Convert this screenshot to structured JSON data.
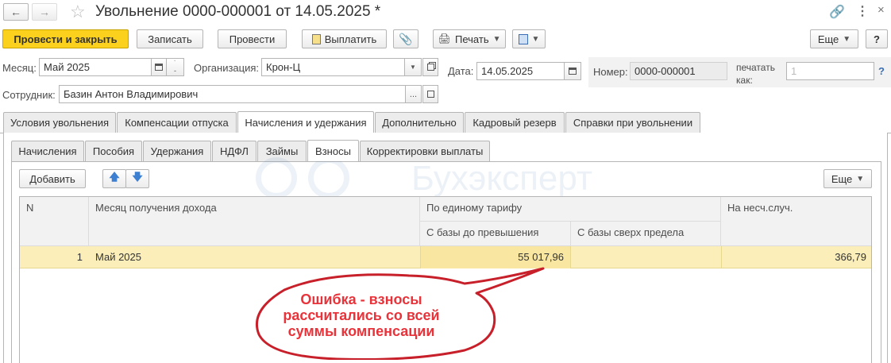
{
  "window": {
    "title": "Увольнение 0000-000001 от 14.05.2025 *"
  },
  "toolbar": {
    "post_close": "Провести и закрыть",
    "save": "Записать",
    "post": "Провести",
    "pay": "Выплатить",
    "print": "Печать",
    "more": "Еще",
    "help": "?"
  },
  "form": {
    "month_label": "Месяц:",
    "month_value": "Май 2025",
    "org_label": "Организация:",
    "org_value": "Крон-Ц",
    "date_label": "Дата:",
    "date_value": "14.05.2025",
    "number_label": "Номер:",
    "number_value": "0000-000001",
    "print_as_label_1": "печатать",
    "print_as_label_2": "как:",
    "print_as_value": "1",
    "print_as_help": "?",
    "employee_label": "Сотрудник:",
    "employee_value": "Базин Антон Владимирович"
  },
  "tabs": [
    "Условия увольнения",
    "Компенсации отпуска",
    "Начисления и удержания",
    "Дополнительно",
    "Кадровый резерв",
    "Справки при увольнении"
  ],
  "subtabs": [
    "Начисления",
    "Пособия",
    "Удержания",
    "НДФЛ",
    "Займы",
    "Взносы",
    "Корректировки выплаты"
  ],
  "table_toolbar": {
    "add": "Добавить",
    "more": "Еще"
  },
  "table": {
    "headers": {
      "n": "N",
      "month": "Месяц получения дохода",
      "single_tariff": "По единому тарифу",
      "below_limit": "С базы до превышения",
      "above_limit": "С базы сверх предела",
      "accident": "На несч.случ."
    },
    "rows": [
      {
        "n": "1",
        "month": "Май 2025",
        "below_limit": "55 017,96",
        "above_limit": "",
        "accident": "366,79"
      }
    ]
  },
  "watermark": "Бухэксперт",
  "callout": {
    "line1": "Ошибка - взносы",
    "line2": "рассчитались со всей",
    "line3": "суммы компенсации"
  },
  "colors": {
    "accent": "#fcd11d",
    "selected_row": "#fbeeb8",
    "callout_text": "#e8333a",
    "callout_border": "#c8202a"
  }
}
